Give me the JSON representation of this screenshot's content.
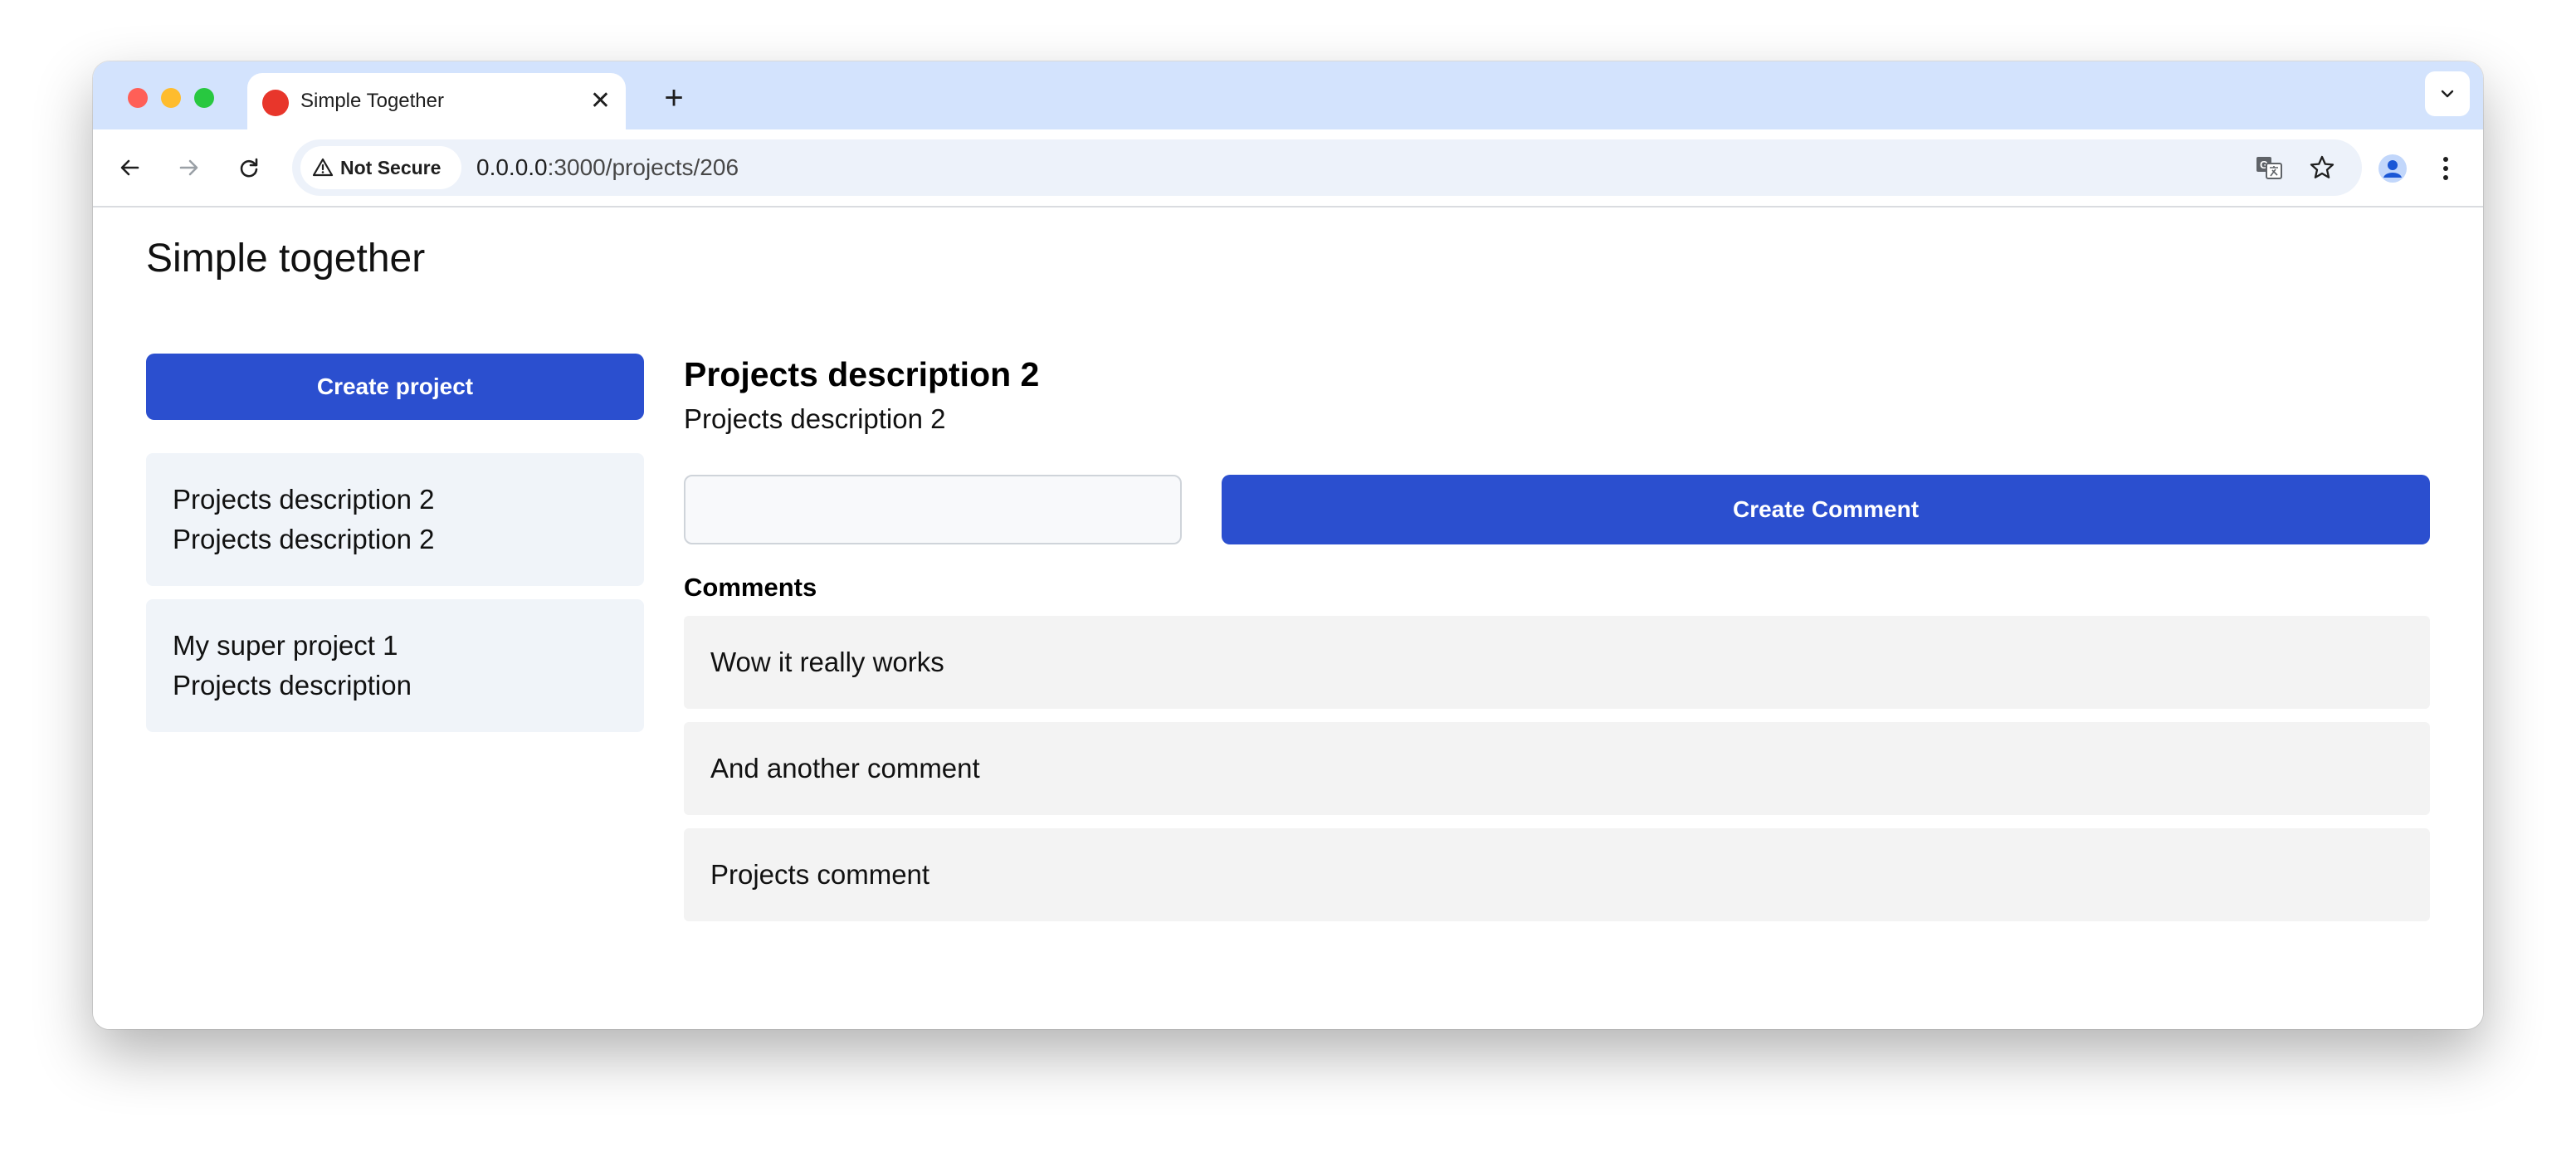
{
  "browser": {
    "tab_title": "Simple Together",
    "tab_close": "✕",
    "new_tab": "+",
    "security_label": "Not Secure",
    "url_host": "0.0.0.0",
    "url_path": ":3000/projects/206"
  },
  "app": {
    "title": "Simple together",
    "create_project_label": "Create project",
    "projects": [
      {
        "name": "Projects description 2",
        "description": "Projects description 2"
      },
      {
        "name": "My super project 1",
        "description": "Projects description"
      }
    ]
  },
  "detail": {
    "title": "Projects description 2",
    "description": "Projects description 2",
    "comment_input_value": "",
    "comment_input_placeholder": "",
    "create_comment_label": "Create Comment",
    "comments_heading": "Comments",
    "comments": [
      "Wow it really works",
      "And another comment",
      "Projects comment"
    ]
  },
  "colors": {
    "accent": "#2b4fcf",
    "tabstrip": "#d3e3fd",
    "card_bg": "#f0f4f9",
    "comment_bg": "#f3f3f3"
  }
}
